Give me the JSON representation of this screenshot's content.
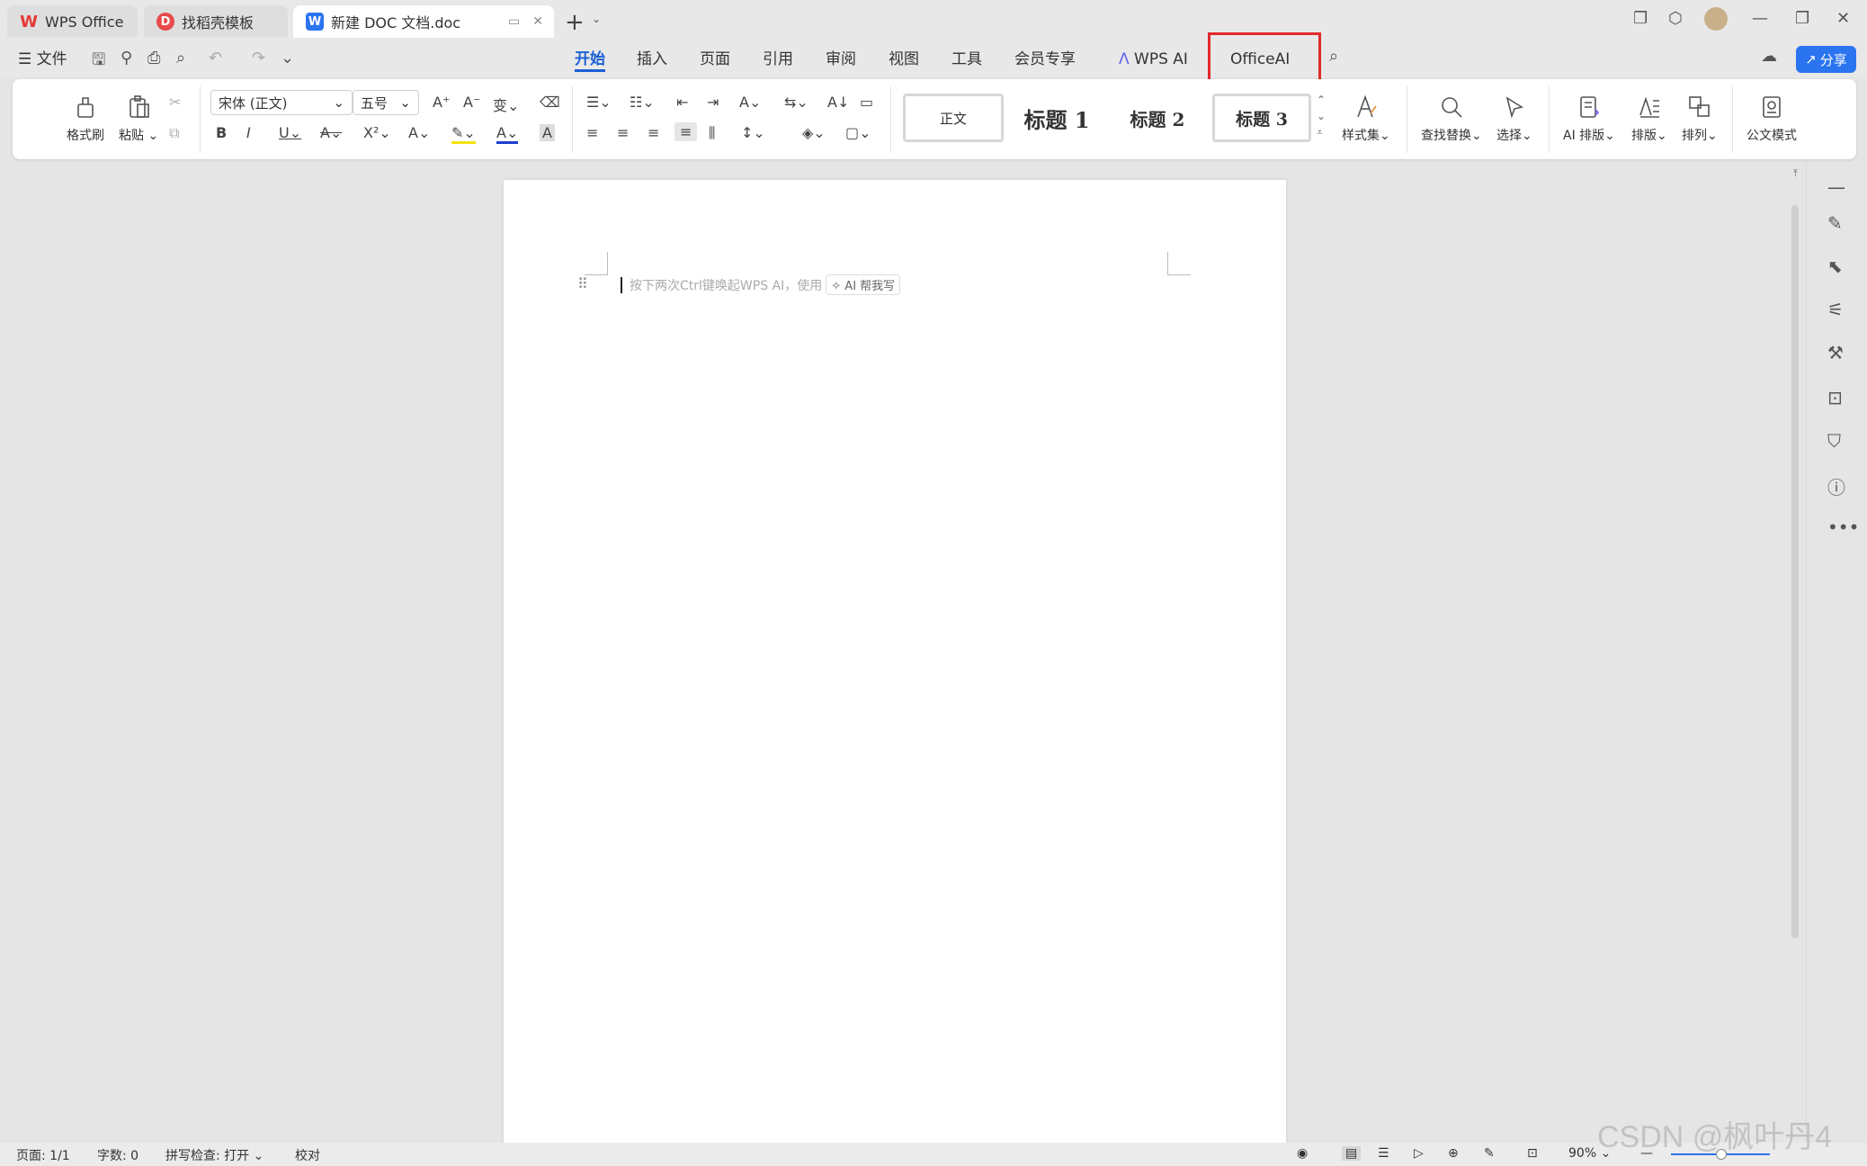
{
  "tabs": [
    {
      "label": "WPS Office"
    },
    {
      "label": "找稻壳模板"
    },
    {
      "label": "新建 DOC 文档.doc"
    }
  ],
  "menu": {
    "file": "文件",
    "items": [
      "开始",
      "插入",
      "页面",
      "引用",
      "审阅",
      "视图",
      "工具",
      "会员专享"
    ],
    "wps_ai": "WPS AI",
    "office_ai": "OfficeAI",
    "share": "分享"
  },
  "ribbon": {
    "format_painter": "格式刷",
    "paste": "粘贴",
    "font_name": "宋体 (正文)",
    "font_size": "五号",
    "styles": [
      "正文",
      "标题 1",
      "标题 2",
      "标题 3"
    ],
    "style_set": "样式集",
    "find_replace": "查找替换",
    "select": "选择",
    "ai_layout": "AI 排版",
    "layout": "排版",
    "arrange": "排列",
    "official_mode": "公文模式"
  },
  "document": {
    "hint": "按下两次Ctrl键唤起WPS AI，使用",
    "ai_write_btn": "AI 帮我写"
  },
  "status": {
    "page": "页面: 1/1",
    "words": "字数: 0",
    "spell": "拼写检查: 打开",
    "proof": "校对",
    "zoom": "90%"
  },
  "watermark": "CSDN @枫叶丹4",
  "colors": {
    "accent": "#1a5fd6",
    "share_bg": "#2b74f0",
    "highlight_box": "#e12a2a"
  }
}
